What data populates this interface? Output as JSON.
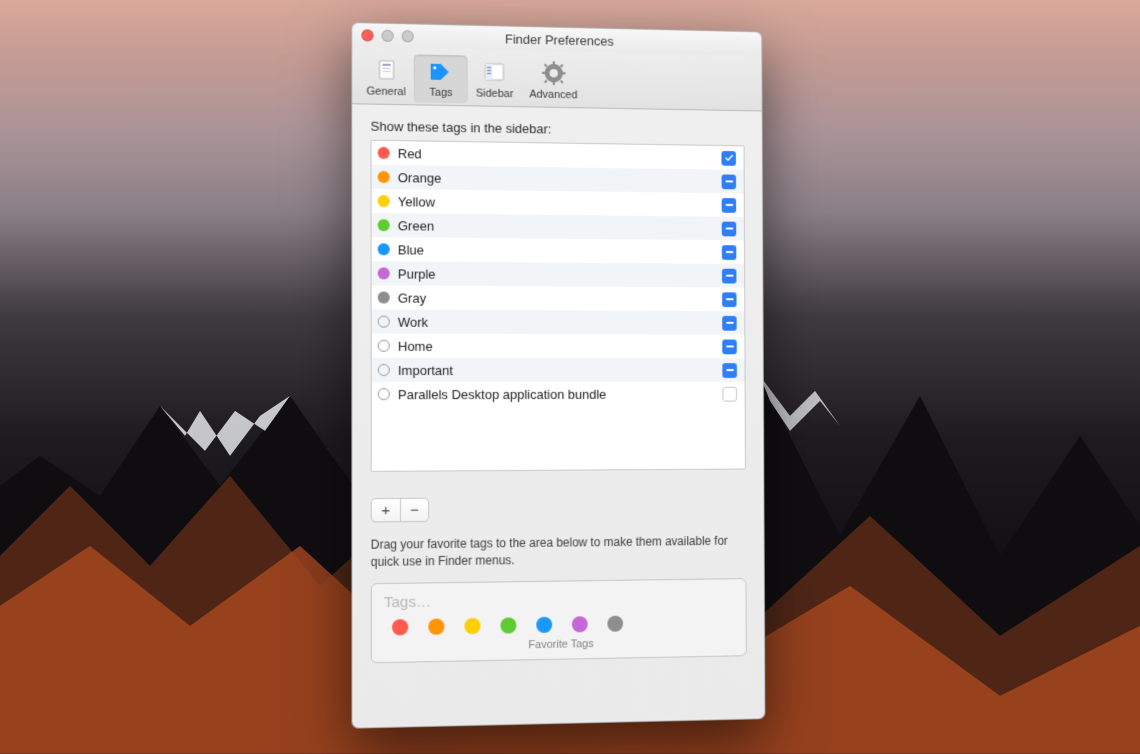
{
  "window": {
    "title": "Finder Preferences"
  },
  "toolbar": {
    "tabs": [
      {
        "id": "general",
        "label": "General",
        "selected": false
      },
      {
        "id": "tags",
        "label": "Tags",
        "selected": true
      },
      {
        "id": "sidebar",
        "label": "Sidebar",
        "selected": false
      },
      {
        "id": "advanced",
        "label": "Advanced",
        "selected": false
      }
    ]
  },
  "tags_section": {
    "heading": "Show these tags in the sidebar:",
    "tags": [
      {
        "name": "Red",
        "color": "#ff5b4f",
        "state": "checked"
      },
      {
        "name": "Orange",
        "color": "#ff9502",
        "state": "mixed"
      },
      {
        "name": "Yellow",
        "color": "#ffcf02",
        "state": "mixed"
      },
      {
        "name": "Green",
        "color": "#5ecb32",
        "state": "mixed"
      },
      {
        "name": "Blue",
        "color": "#1998ff",
        "state": "mixed"
      },
      {
        "name": "Purple",
        "color": "#c667d8",
        "state": "mixed"
      },
      {
        "name": "Gray",
        "color": "#8e8e8e",
        "state": "mixed"
      },
      {
        "name": "Work",
        "color": "outline",
        "state": "mixed"
      },
      {
        "name": "Home",
        "color": "outline",
        "state": "mixed"
      },
      {
        "name": "Important",
        "color": "outline",
        "state": "mixed"
      },
      {
        "name": "Parallels Desktop application bundle",
        "color": "outline",
        "state": "empty"
      }
    ],
    "add_label": "+",
    "remove_label": "−",
    "hint": "Drag your favorite tags to the area below to make them available for quick use in Finder menus.",
    "favorites_placeholder": "Tags…",
    "favorites_caption": "Favorite Tags",
    "favorite_colors": [
      "#ff5b4f",
      "#ff9502",
      "#ffcf02",
      "#5ecb32",
      "#1998ff",
      "#c667d8",
      "#8e8e8e"
    ]
  }
}
